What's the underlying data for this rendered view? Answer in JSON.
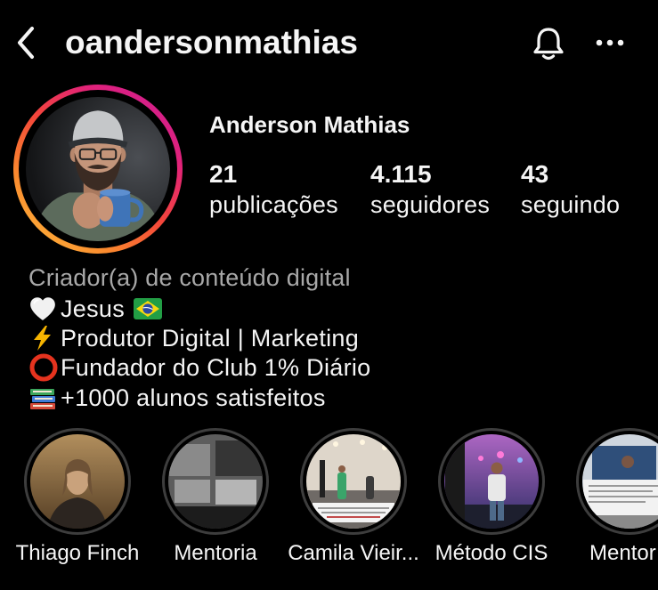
{
  "header": {
    "username": "oandersonmathias",
    "back_icon": "chevron-left-icon",
    "notifications_icon": "bell-icon",
    "more_icon": "more-horizontal-icon"
  },
  "profile": {
    "name": "Anderson Mathias",
    "stats": [
      {
        "value": "21",
        "label": "publicações"
      },
      {
        "value": "4.115",
        "label": "seguidores"
      },
      {
        "value": "43",
        "label": "seguindo"
      }
    ]
  },
  "bio": {
    "category": "Criador(a) de conteúdo digital",
    "lines": [
      {
        "icon": "white-heart-icon",
        "text": "Jesus",
        "trailing_icon": "brazil-flag-icon"
      },
      {
        "icon": "high-voltage-icon",
        "text": "Produtor Digital | Marketing"
      },
      {
        "icon": "hollow-red-circle-icon",
        "text": "Fundador do Club 1% Diário"
      },
      {
        "icon": "books-icon",
        "text": "+1000 alunos satisfeitos"
      }
    ]
  },
  "highlights": [
    {
      "label": "Thiago Finch"
    },
    {
      "label": "Mentoria"
    },
    {
      "label": "Camila Vieir..."
    },
    {
      "label": "Método CIS"
    },
    {
      "label": "Mentor"
    }
  ],
  "colors": {
    "background": "#000000",
    "text": "#f5f5f5",
    "secondary_text": "#a8a8a8",
    "story_ring": [
      "#fdc43f",
      "#fb8a2e",
      "#f4463a",
      "#e1227a",
      "#c71c9a"
    ],
    "highlight_ring": "#3d3d3d"
  }
}
